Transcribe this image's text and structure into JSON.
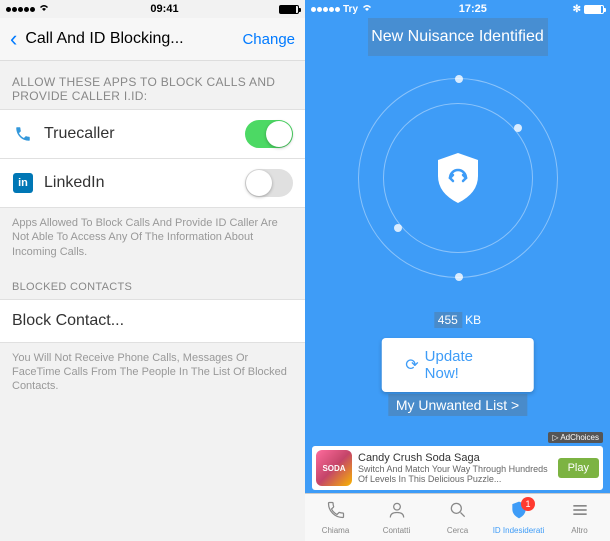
{
  "left": {
    "status": {
      "time": "09:41",
      "carrier": "•••••"
    },
    "nav": {
      "title": "Call And ID Blocking...",
      "action": "Change"
    },
    "section1": {
      "header": "ALLOW THESE APPS TO BLOCK CALLS AND PROVIDE CALLER I.ID:"
    },
    "apps": [
      {
        "name": "Truecaller",
        "enabled": true,
        "icon": "phone"
      },
      {
        "name": "LinkedIn",
        "enabled": false,
        "icon": "linkedin",
        "iconText": "in"
      }
    ],
    "footer1": "Apps Allowed To Block Calls And Provide ID Caller Are Not Able To Access Any Of The Information About Incoming Calls.",
    "section2": {
      "header": "BLOCKED CONTACTS"
    },
    "blockRow": {
      "label": "Block Contact..."
    },
    "footer2": "You Will Not Receive Phone Calls, Messages Or FaceTime Calls From The People In The List Of Blocked Contacts."
  },
  "right": {
    "status": {
      "carrier": "Try",
      "time": "17:25"
    },
    "header": "New Nuisance Identified",
    "kb": {
      "num": "455",
      "unit": "KB"
    },
    "updateBtn": "Update Now!",
    "unwantedLink": "My Unwanted List >",
    "ad": {
      "title": "Candy Crush Soda Saga",
      "subtitle": "Switch And Match Your Way Through Hundreds Of Levels In This Delicious Puzzle...",
      "cta": "Play",
      "choices": "AdChoices",
      "iconText": "SODA"
    },
    "tabs": [
      {
        "label": "Chiama",
        "icon": "phone"
      },
      {
        "label": "Contatti",
        "icon": "person"
      },
      {
        "label": "Cerca",
        "icon": "search"
      },
      {
        "label": "ID Indesiderati",
        "icon": "shield",
        "active": true,
        "badge": "1"
      },
      {
        "label": "Altro",
        "icon": "menu"
      }
    ]
  }
}
